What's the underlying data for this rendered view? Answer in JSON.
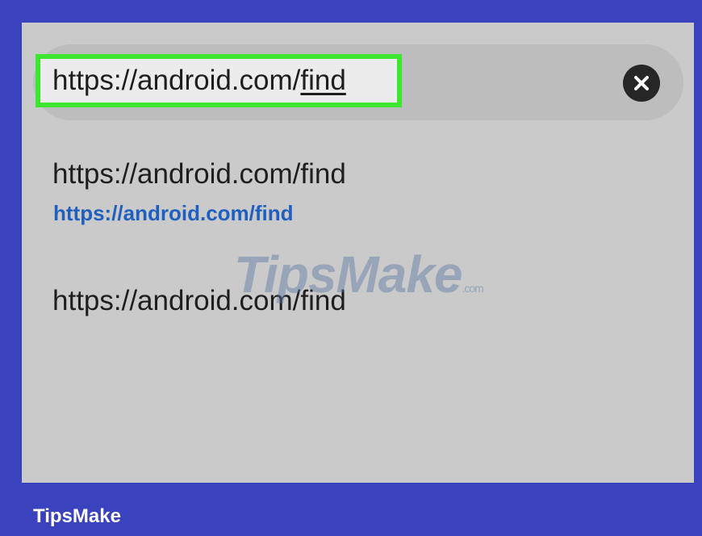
{
  "search": {
    "url_prefix": "https://android.com/",
    "url_suffix": "find",
    "clear_icon": "close-circle-icon"
  },
  "suggestions": [
    {
      "title": "https://android.com/find",
      "url": "https://android.com/find"
    },
    {
      "title": "https://android.com/find"
    }
  ],
  "watermark": {
    "main": "TipsMake",
    "suffix": ".com"
  },
  "footer": {
    "brand": "TipsMake"
  },
  "colors": {
    "frame": "#3a43bd",
    "screen": "#cacaca",
    "highlight": "#3ee632",
    "link": "#1f5fbf"
  }
}
